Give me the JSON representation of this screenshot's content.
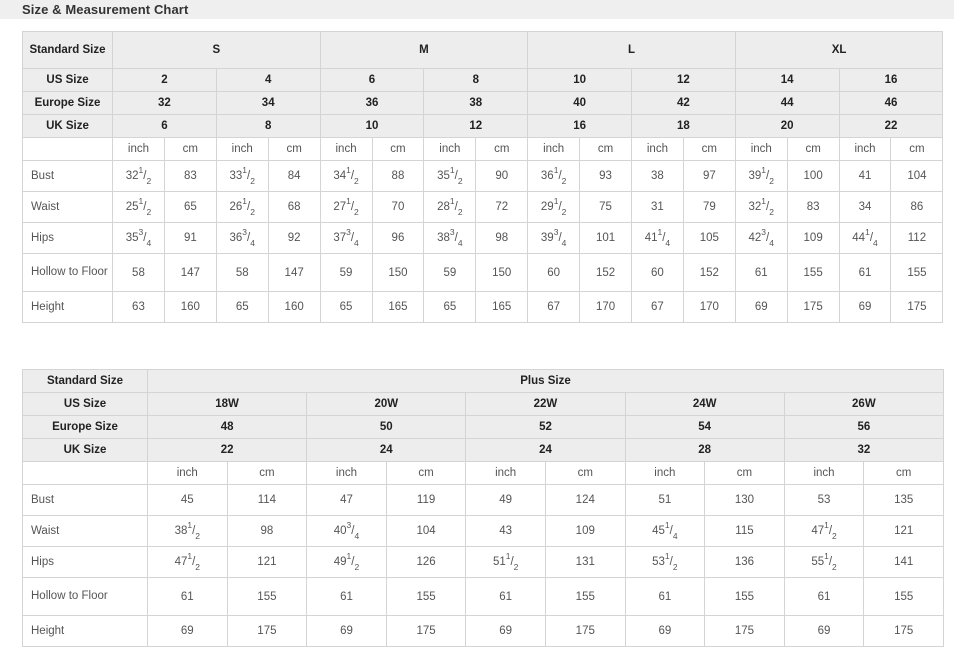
{
  "header": {
    "title": "Size & Measurement Chart"
  },
  "standard_table": {
    "corner_label": "Standard Size",
    "row_labels": {
      "us": "US Size",
      "europe": "Europe Size",
      "uk": "UK Size",
      "bust": "Bust",
      "waist": "Waist",
      "hips": "Hips",
      "hollow": "Hollow to Floor",
      "height": "Height"
    },
    "unit_labels": [
      "inch",
      "cm",
      "inch",
      "cm",
      "inch",
      "cm",
      "inch",
      "cm",
      "inch",
      "cm",
      "inch",
      "cm",
      "inch",
      "cm",
      "inch",
      "cm"
    ],
    "size_groups": [
      {
        "label": "S",
        "span": 4
      },
      {
        "label": "M",
        "span": 4
      },
      {
        "label": "L",
        "span": 4
      },
      {
        "label": "XL",
        "span": 4
      }
    ],
    "us_sizes": [
      "2",
      "4",
      "6",
      "8",
      "10",
      "12",
      "14",
      "16"
    ],
    "europe_sizes": [
      "32",
      "34",
      "36",
      "38",
      "40",
      "42",
      "44",
      "46"
    ],
    "uk_sizes": [
      "6",
      "8",
      "10",
      "12",
      "16",
      "18",
      "20",
      "22"
    ],
    "measurements": [
      {
        "label": "Bust",
        "values": [
          {
            "whole": "32",
            "num": "1",
            "den": "2"
          },
          {
            "whole": "83"
          },
          {
            "whole": "33",
            "num": "1",
            "den": "2"
          },
          {
            "whole": "84"
          },
          {
            "whole": "34",
            "num": "1",
            "den": "2"
          },
          {
            "whole": "88"
          },
          {
            "whole": "35",
            "num": "1",
            "den": "2"
          },
          {
            "whole": "90"
          },
          {
            "whole": "36",
            "num": "1",
            "den": "2"
          },
          {
            "whole": "93"
          },
          {
            "whole": "38"
          },
          {
            "whole": "97"
          },
          {
            "whole": "39",
            "num": "1",
            "den": "2"
          },
          {
            "whole": "100"
          },
          {
            "whole": "41"
          },
          {
            "whole": "104"
          }
        ]
      },
      {
        "label": "Waist",
        "values": [
          {
            "whole": "25",
            "num": "1",
            "den": "2"
          },
          {
            "whole": "65"
          },
          {
            "whole": "26",
            "num": "1",
            "den": "2"
          },
          {
            "whole": "68"
          },
          {
            "whole": "27",
            "num": "1",
            "den": "2"
          },
          {
            "whole": "70"
          },
          {
            "whole": "28",
            "num": "1",
            "den": "2"
          },
          {
            "whole": "72"
          },
          {
            "whole": "29",
            "num": "1",
            "den": "2"
          },
          {
            "whole": "75"
          },
          {
            "whole": "31"
          },
          {
            "whole": "79"
          },
          {
            "whole": "32",
            "num": "1",
            "den": "2"
          },
          {
            "whole": "83"
          },
          {
            "whole": "34"
          },
          {
            "whole": "86"
          }
        ]
      },
      {
        "label": "Hips",
        "values": [
          {
            "whole": "35",
            "num": "3",
            "den": "4"
          },
          {
            "whole": "91"
          },
          {
            "whole": "36",
            "num": "3",
            "den": "4"
          },
          {
            "whole": "92"
          },
          {
            "whole": "37",
            "num": "3",
            "den": "4"
          },
          {
            "whole": "96"
          },
          {
            "whole": "38",
            "num": "3",
            "den": "4"
          },
          {
            "whole": "98"
          },
          {
            "whole": "39",
            "num": "3",
            "den": "4"
          },
          {
            "whole": "101"
          },
          {
            "whole": "41",
            "num": "1",
            "den": "4"
          },
          {
            "whole": "105"
          },
          {
            "whole": "42",
            "num": "3",
            "den": "4"
          },
          {
            "whole": "109"
          },
          {
            "whole": "44",
            "num": "1",
            "den": "4"
          },
          {
            "whole": "112"
          }
        ]
      },
      {
        "label": "Hollow to Floor",
        "values": [
          {
            "whole": "58"
          },
          {
            "whole": "147"
          },
          {
            "whole": "58"
          },
          {
            "whole": "147"
          },
          {
            "whole": "59"
          },
          {
            "whole": "150"
          },
          {
            "whole": "59"
          },
          {
            "whole": "150"
          },
          {
            "whole": "60"
          },
          {
            "whole": "152"
          },
          {
            "whole": "60"
          },
          {
            "whole": "152"
          },
          {
            "whole": "61"
          },
          {
            "whole": "155"
          },
          {
            "whole": "61"
          },
          {
            "whole": "155"
          }
        ]
      },
      {
        "label": "Height",
        "values": [
          {
            "whole": "63"
          },
          {
            "whole": "160"
          },
          {
            "whole": "65"
          },
          {
            "whole": "160"
          },
          {
            "whole": "65"
          },
          {
            "whole": "165"
          },
          {
            "whole": "65"
          },
          {
            "whole": "165"
          },
          {
            "whole": "67"
          },
          {
            "whole": "170"
          },
          {
            "whole": "67"
          },
          {
            "whole": "170"
          },
          {
            "whole": "69"
          },
          {
            "whole": "175"
          },
          {
            "whole": "69"
          },
          {
            "whole": "175"
          }
        ]
      }
    ]
  },
  "plus_table": {
    "corner_label": "Standard Size",
    "group_label": "Plus Size",
    "row_labels": {
      "us": "US Size",
      "europe": "Europe Size",
      "uk": "UK Size",
      "bust": "Bust",
      "waist": "Waist",
      "hips": "Hips",
      "hollow": "Hollow to Floor",
      "height": "Height"
    },
    "unit_labels": [
      "inch",
      "cm",
      "inch",
      "cm",
      "inch",
      "cm",
      "inch",
      "cm",
      "inch",
      "cm"
    ],
    "us_sizes": [
      "18W",
      "20W",
      "22W",
      "24W",
      "26W"
    ],
    "europe_sizes": [
      "48",
      "50",
      "52",
      "54",
      "56"
    ],
    "uk_sizes": [
      "22",
      "24",
      "24",
      "28",
      "32"
    ],
    "measurements": [
      {
        "label": "Bust",
        "values": [
          {
            "whole": "45"
          },
          {
            "whole": "114"
          },
          {
            "whole": "47"
          },
          {
            "whole": "119"
          },
          {
            "whole": "49"
          },
          {
            "whole": "124"
          },
          {
            "whole": "51"
          },
          {
            "whole": "130"
          },
          {
            "whole": "53"
          },
          {
            "whole": "135"
          }
        ]
      },
      {
        "label": "Waist",
        "values": [
          {
            "whole": "38",
            "num": "1",
            "den": "2"
          },
          {
            "whole": "98"
          },
          {
            "whole": "40",
            "num": "3",
            "den": "4"
          },
          {
            "whole": "104"
          },
          {
            "whole": "43"
          },
          {
            "whole": "109"
          },
          {
            "whole": "45",
            "num": "1",
            "den": "4"
          },
          {
            "whole": "115"
          },
          {
            "whole": "47",
            "num": "1",
            "den": "2"
          },
          {
            "whole": "121"
          }
        ]
      },
      {
        "label": "Hips",
        "values": [
          {
            "whole": "47",
            "num": "1",
            "den": "2"
          },
          {
            "whole": "121"
          },
          {
            "whole": "49",
            "num": "1",
            "den": "2"
          },
          {
            "whole": "126"
          },
          {
            "whole": "51",
            "num": "1",
            "den": "2"
          },
          {
            "whole": "131"
          },
          {
            "whole": "53",
            "num": "1",
            "den": "2"
          },
          {
            "whole": "136"
          },
          {
            "whole": "55",
            "num": "1",
            "den": "2"
          },
          {
            "whole": "141"
          }
        ]
      },
      {
        "label": "Hollow to Floor",
        "values": [
          {
            "whole": "61"
          },
          {
            "whole": "155"
          },
          {
            "whole": "61"
          },
          {
            "whole": "155"
          },
          {
            "whole": "61"
          },
          {
            "whole": "155"
          },
          {
            "whole": "61"
          },
          {
            "whole": "155"
          },
          {
            "whole": "61"
          },
          {
            "whole": "155"
          }
        ]
      },
      {
        "label": "Height",
        "values": [
          {
            "whole": "69"
          },
          {
            "whole": "175"
          },
          {
            "whole": "69"
          },
          {
            "whole": "175"
          },
          {
            "whole": "69"
          },
          {
            "whole": "175"
          },
          {
            "whole": "69"
          },
          {
            "whole": "175"
          },
          {
            "whole": "69"
          },
          {
            "whole": "175"
          }
        ]
      }
    ]
  },
  "colors": {
    "band_bg": "#efefef",
    "header_bg": "#ededed",
    "border": "#d4d4d4",
    "text": "#333333",
    "muted_text": "#555555"
  }
}
